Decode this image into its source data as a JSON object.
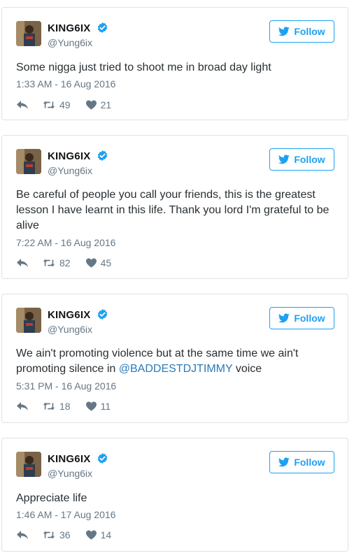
{
  "colors": {
    "accent": "#1da1f2",
    "muted": "#657786",
    "mention": "#2b7bb9",
    "border": "#dbe3e8"
  },
  "follow_label": "Follow",
  "tweets": [
    {
      "name": "KING6IX",
      "handle": "@Yung6ix",
      "text": "Some nigga just tried to shoot me in broad day light",
      "time": "1:33 AM - 16 Aug 2016",
      "retweets": "49",
      "likes": "21"
    },
    {
      "name": "KING6IX",
      "handle": "@Yung6ix",
      "text": "Be careful of people you call your friends, this is the greatest lesson I have learnt in this life. Thank you lord I'm grateful to be alive",
      "time": "7:22 AM - 16 Aug 2016",
      "retweets": "82",
      "likes": "45"
    },
    {
      "name": "KING6IX",
      "handle": "@Yung6ix",
      "text_before": "We ain't promoting violence but at the same time we ain't promoting silence in ",
      "mention": "@BADDESTDJTIMMY",
      "text_after": " voice",
      "time": "5:31 PM - 16 Aug 2016",
      "retweets": "18",
      "likes": "11"
    },
    {
      "name": "KING6IX",
      "handle": "@Yung6ix",
      "text": "Appreciate life",
      "time": "1:46 AM - 17 Aug 2016",
      "retweets": "36",
      "likes": "14"
    }
  ]
}
